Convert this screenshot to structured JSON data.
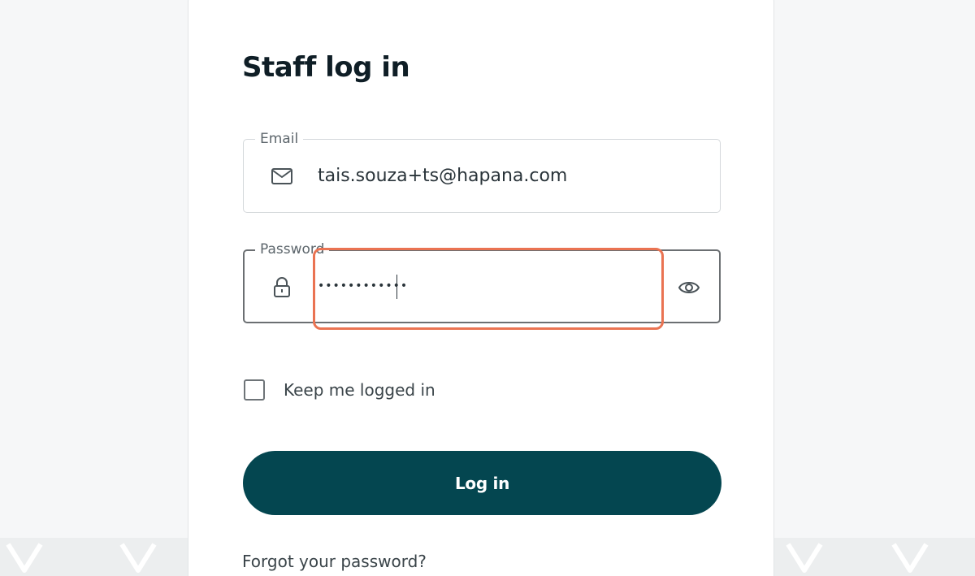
{
  "page": {
    "title": "Staff log in"
  },
  "email": {
    "label": "Email",
    "value": "tais.souza+ts@hapana.com",
    "icon": "mail-icon"
  },
  "password": {
    "label": "Password",
    "masked_value": "••••••••••••",
    "icon": "lock-icon",
    "toggle_icon": "eye-icon"
  },
  "keep_logged_in": {
    "label": "Keep me logged in",
    "checked": false
  },
  "login_button": {
    "label": "Log in"
  },
  "forgot_link": {
    "label": "Forgot your password?"
  },
  "colors": {
    "primary": "#044650",
    "highlight": "#ea7352",
    "background": "#f6f7f8"
  }
}
